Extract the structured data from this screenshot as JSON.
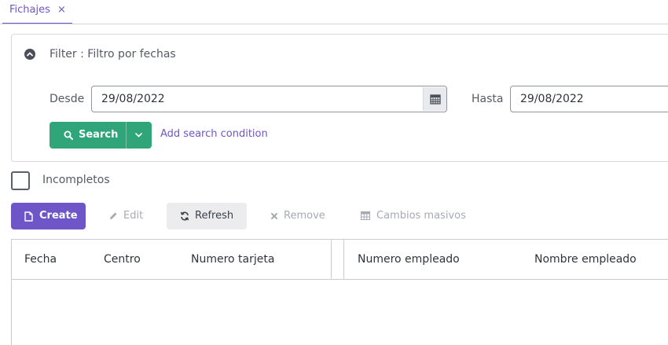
{
  "tabs": [
    {
      "label": "Fichajes",
      "close": "×",
      "active": true
    }
  ],
  "filter": {
    "title": "Filter : Filtro por fechas",
    "desde_label": "Desde",
    "desde_value": "29/08/2022",
    "hasta_label": "Hasta",
    "hasta_value": "29/08/2022",
    "search_label": "Search",
    "add_condition_label": "Add search condition"
  },
  "incompletos": {
    "label": "Incompletos",
    "checked": false
  },
  "toolbar": {
    "create_label": "Create",
    "edit_label": "Edit",
    "refresh_label": "Refresh",
    "remove_label": "Remove",
    "cambios_label": "Cambios masivos"
  },
  "grid": {
    "columns": [
      "Fecha",
      "Centro",
      "Numero tarjeta",
      "Numero empleado",
      "Nombre empleado"
    ],
    "rows": []
  },
  "colors": {
    "accent": "#6f56c8",
    "search_button": "#2fa579",
    "refresh_button_bg": "#ececee",
    "disabled_text": "#a6aab2"
  },
  "icons": {
    "collapse": "chevron-up-circle-icon",
    "calendar": "calendar-icon",
    "search": "search-icon",
    "dropdown": "chevron-down-icon",
    "create": "file-icon",
    "edit": "pencil-icon",
    "refresh": "refresh-icon",
    "remove": "close-icon",
    "cambios": "table-icon"
  }
}
